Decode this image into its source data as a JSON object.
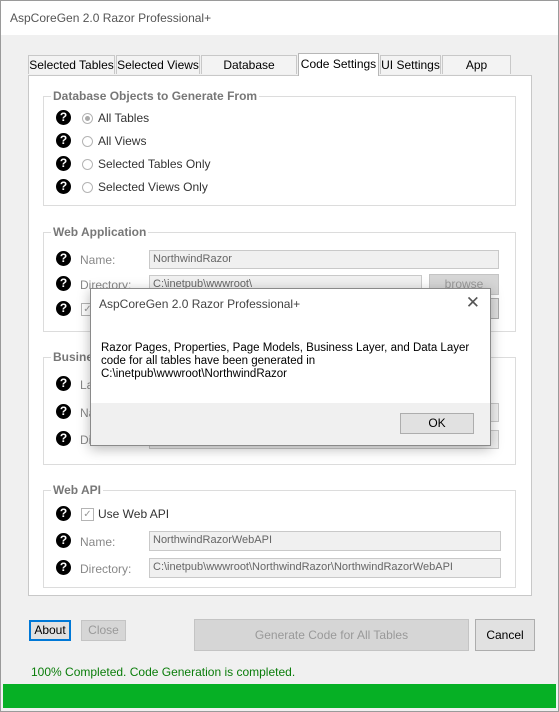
{
  "window": {
    "title": "AspCoreGen 2.0 Razor Professional+"
  },
  "tabs": [
    {
      "label": "Selected Tables",
      "active": false
    },
    {
      "label": "Selected Views",
      "active": false
    },
    {
      "label": "Database Settings",
      "active": false
    },
    {
      "label": "Code Settings",
      "active": true
    },
    {
      "label": "UI Settings",
      "active": false
    },
    {
      "label": "App Settings",
      "active": false
    }
  ],
  "db_objects": {
    "title": "Database Objects to Generate From",
    "options": [
      {
        "label": "All Tables",
        "checked": true
      },
      {
        "label": "All Views",
        "checked": false
      },
      {
        "label": "Selected Tables Only",
        "checked": false
      },
      {
        "label": "Selected Views Only",
        "checked": false
      }
    ]
  },
  "web_app": {
    "title": "Web Application",
    "name_label": "Name:",
    "name_value": "NorthwindRazor",
    "dir_label": "Directory:",
    "dir_value": "C:\\inetpub\\wwwroot\\",
    "browse_label": "browse"
  },
  "business": {
    "title": "Busine",
    "layer_label": "La",
    "name_label": "Na",
    "dir_label": "Dir"
  },
  "web_api": {
    "title": "Web API",
    "use_label": "Use Web API",
    "use_checked": true,
    "name_label": "Name:",
    "name_value": "NorthwindRazorWebAPI",
    "dir_label": "Directory:",
    "dir_value": "C:\\inetpub\\wwwroot\\NorthwindRazor\\NorthwindRazorWebAPI"
  },
  "buttons": {
    "about": "About",
    "close": "Close",
    "generate": "Generate Code for All Tables",
    "cancel": "Cancel"
  },
  "status": {
    "text": "100% Completed.  Code Generation is completed.",
    "progress_percent": 100,
    "progress_color": "#06b025"
  },
  "dialog": {
    "title": "AspCoreGen 2.0 Razor Professional+",
    "message_line1": "Razor Pages, Properties, Page Models, Business Layer, and Data Layer",
    "message_line2": "code for all tables have been generated in",
    "message_line3": "C:\\inetpub\\wwwroot\\NorthwindRazor",
    "ok": "OK"
  }
}
